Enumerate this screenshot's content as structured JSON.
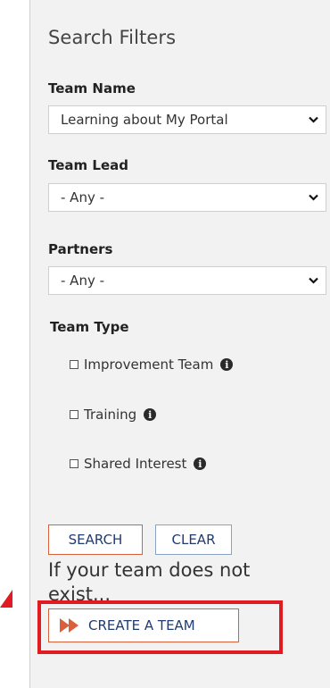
{
  "filters": {
    "title": "Search Filters",
    "team_name": {
      "label": "Team Name",
      "selected": "Learning about My Portal"
    },
    "team_lead": {
      "label": "Team Lead",
      "selected": "- Any -"
    },
    "partners": {
      "label": "Partners",
      "selected": "- Any -"
    },
    "team_type": {
      "label": "Team Type",
      "options": [
        {
          "label": "Improvement Team",
          "checked": false
        },
        {
          "label": "Training",
          "checked": false
        },
        {
          "label": "Shared Interest",
          "checked": false
        }
      ]
    }
  },
  "actions": {
    "search_label": "SEARCH",
    "clear_label": "CLEAR"
  },
  "create": {
    "note": "If your team does not exist...",
    "button_label": "CREATE A TEAM"
  },
  "icons": {
    "info": "info-circle-icon",
    "chevron": "chevron-down-icon",
    "double_arrow": "double-chevron-right-icon"
  },
  "colors": {
    "panel_bg": "#f2f2f2",
    "accent_orange": "#d9603a",
    "link_blue": "#1f3b73",
    "highlight_red": "#e11b22"
  }
}
